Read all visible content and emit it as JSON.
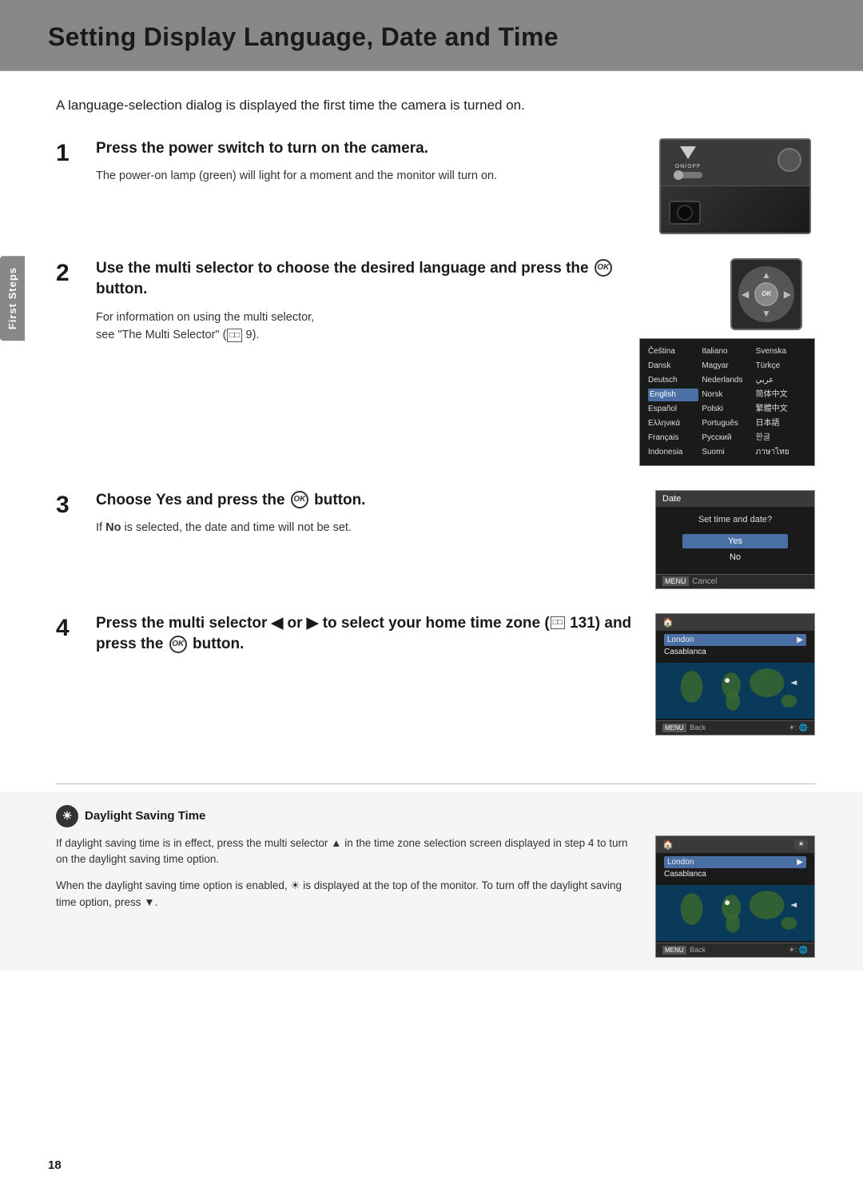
{
  "page": {
    "title": "Setting Display Language, Date and Time",
    "intro": "A language-selection dialog is displayed the first time the camera is turned on.",
    "page_number": "18"
  },
  "side_tab": {
    "label": "First Steps"
  },
  "steps": [
    {
      "number": "1",
      "heading": "Press the power switch to turn on the camera.",
      "description": "The power-on lamp (green) will light for a moment and the monitor will turn on."
    },
    {
      "number": "2",
      "heading": "Use the multi selector to choose the desired language and press the ⒪ button.",
      "description": "For information on using the multi selector, see “The Multi Selector” (",
      "ref_page": "9",
      "description_end": ")."
    },
    {
      "number": "3",
      "heading": "Choose Yes and press the ⒪ button.",
      "description": "If No is selected, the date and time will not be set."
    },
    {
      "number": "4",
      "heading": "Press the multi selector ◄ or ► to select your home time zone (",
      "ref_page": "131",
      "heading_end": ") and press the ⒪ button.",
      "extra_line": "button."
    }
  ],
  "dialog": {
    "title": "Date",
    "question": "Set time and date?",
    "options": [
      "Yes",
      "No"
    ],
    "selected": "Yes",
    "footer": "Cancel"
  },
  "world_map": {
    "cities": [
      "London",
      "Casablanca"
    ],
    "selected_city": "London",
    "footer_back": "Back"
  },
  "lang_grid": {
    "items": [
      "Čeština",
      "Italiano",
      "Svenska",
      "Dansk",
      "Magyar",
      "Türkçe",
      "Deutsch",
      "Nederlands",
      "عربي",
      "English",
      "Norsk",
      "简体中文",
      "Español",
      "Polski",
      "繁體中文",
      "Ελληνικά",
      "Português",
      "日本語",
      "Français",
      "Русский",
      "한글",
      "Indonesia",
      "Suomi",
      "ภาษาไทย"
    ],
    "selected": "English"
  },
  "note": {
    "title": "Daylight Saving Time",
    "para1": "If daylight saving time is in effect, press the multi selector ▲ in the time zone selection screen displayed in step 4 to turn on the daylight saving time option.",
    "para2": "When the daylight saving time option is enabled, ☀ is displayed at the top of the monitor. To turn off the daylight saving time option, press ▼."
  },
  "camera_labels": {
    "on_off": "ON/OFF"
  }
}
